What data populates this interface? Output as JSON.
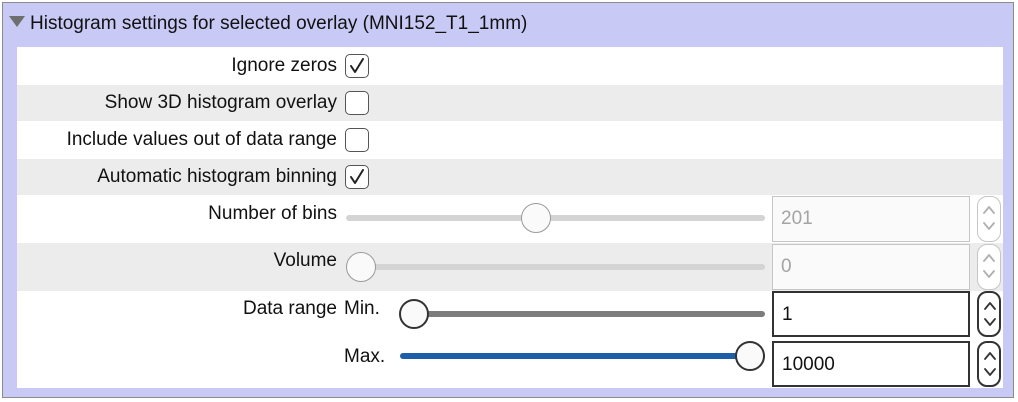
{
  "panel": {
    "title": "Histogram settings for selected overlay (MNI152_T1_1mm)",
    "expanded": true
  },
  "settings": {
    "ignore_zeros": {
      "label": "Ignore zeros",
      "checked": true
    },
    "show_3d": {
      "label": "Show 3D histogram overlay",
      "checked": false
    },
    "include_out_of_range": {
      "label": "Include values out of data range",
      "checked": false
    },
    "auto_binning": {
      "label": "Automatic histogram binning",
      "checked": true
    },
    "num_bins": {
      "label": "Number of bins",
      "value": "201",
      "enabled": false,
      "fraction": 0.45
    },
    "volume": {
      "label": "Volume",
      "value": "0",
      "enabled": false,
      "fraction": 0.0
    },
    "data_range": {
      "label": "Data range",
      "min_label": "Min.",
      "min_value": "1",
      "min_fraction": 0.0,
      "max_label": "Max.",
      "max_value": "10000",
      "max_fraction": 1.0
    }
  },
  "colors": {
    "panel_bg": "#c9c9f5",
    "row_alt": "#ececec",
    "slider_active": "#1c5fa8",
    "disabled_text": "#a4a4a4"
  }
}
